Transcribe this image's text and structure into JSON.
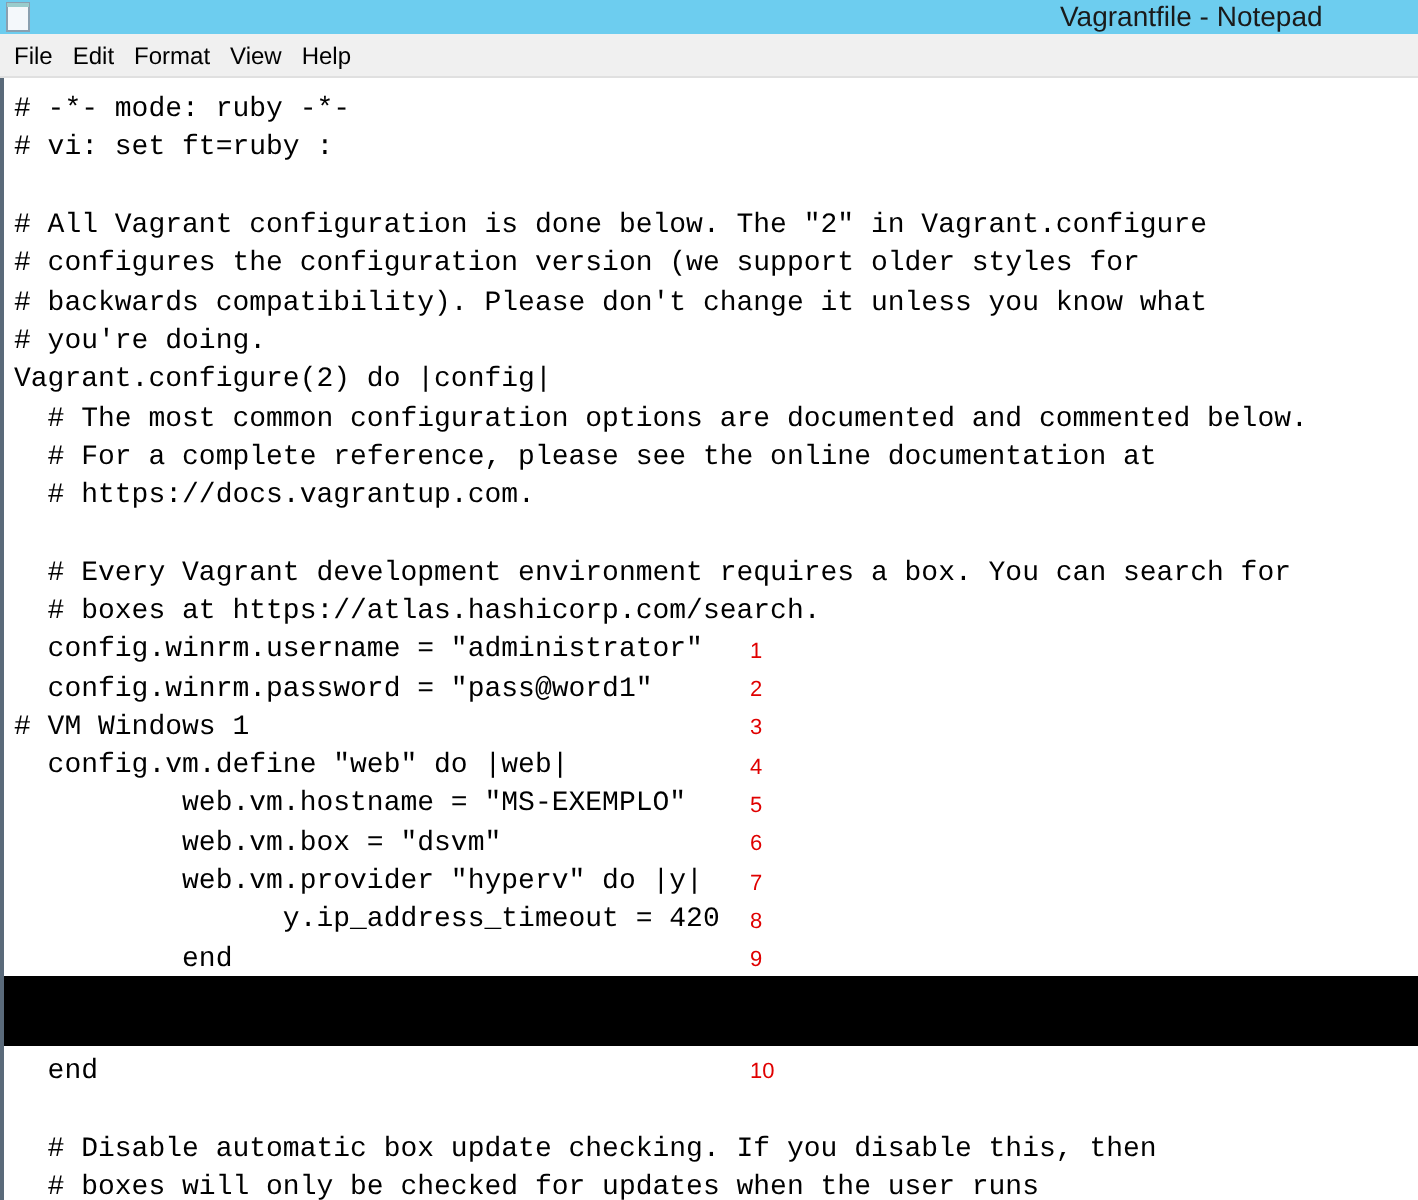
{
  "window": {
    "title": "Vagrantfile - Notepad"
  },
  "menu": [
    "File",
    "Edit",
    "Format",
    "View",
    "Help"
  ],
  "lines": [
    {
      "kind": "text",
      "text": "# -*- mode: ruby -*-"
    },
    {
      "kind": "text",
      "text": "# vi: set ft=ruby :"
    },
    {
      "kind": "text"
    },
    {
      "kind": "text",
      "text": "# All Vagrant configuration is done below. The \"2\" in Vagrant.configure"
    },
    {
      "kind": "text",
      "text": "# configures the configuration version (we support older styles for"
    },
    {
      "kind": "text",
      "text": "# backwards compatibility). Please don't change it unless you know what"
    },
    {
      "kind": "text",
      "text": "# you're doing."
    },
    {
      "kind": "text",
      "text": "Vagrant.configure(2) do |config|"
    },
    {
      "kind": "text",
      "text": "  # The most common configuration options are documented and commented below."
    },
    {
      "kind": "text",
      "text": "  # For a complete reference, please see the online documentation at"
    },
    {
      "kind": "text",
      "text": "  # https://docs.vagrantup.com."
    },
    {
      "kind": "text"
    },
    {
      "kind": "text",
      "text": "  # Every Vagrant development environment requires a box. You can search for"
    },
    {
      "kind": "text",
      "text": "  # boxes at https://atlas.hashicorp.com/search."
    },
    {
      "kind": "text",
      "text": "  config.winrm.username = \"administrator\"",
      "marker": "1"
    },
    {
      "kind": "text",
      "text": "  config.winrm.password = \"pass@word1\"",
      "marker": "2"
    },
    {
      "kind": "text",
      "text": "# VM Windows 1",
      "marker": "3"
    },
    {
      "kind": "text",
      "text": "  config.vm.define \"web\" do |web|",
      "marker": "4"
    },
    {
      "kind": "text",
      "text": "          web.vm.hostname = \"MS-EXEMPLO\"",
      "marker": "5"
    },
    {
      "kind": "text",
      "text": "          web.vm.box = \"dsvm\"",
      "marker": "6"
    },
    {
      "kind": "text",
      "text": "          web.vm.provider \"hyperv\" do |y|",
      "marker": "7"
    },
    {
      "kind": "text",
      "text": "                y.ip_address_timeout = 420",
      "marker": "8"
    },
    {
      "kind": "text",
      "text": "          end",
      "marker": "9"
    },
    {
      "kind": "redacted"
    },
    {
      "kind": "text",
      "text": "  end",
      "marker": "10"
    },
    {
      "kind": "text"
    },
    {
      "kind": "text",
      "text": "  # Disable automatic box update checking. If you disable this, then"
    },
    {
      "kind": "text",
      "text": "  # boxes will only be checked for updates when the user runs"
    }
  ]
}
